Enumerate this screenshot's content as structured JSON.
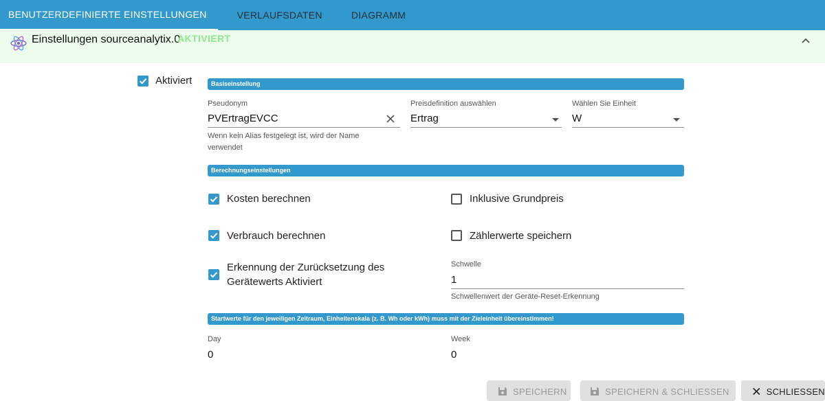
{
  "tabs": [
    {
      "label": "BENUTZERDEFINIERTE EINSTELLUNGEN"
    },
    {
      "label": "VERLAUFSDATEN"
    },
    {
      "label": "DIAGRAMM"
    }
  ],
  "accordion": {
    "title": "Einstellungen sourceanalytix.0",
    "status": "AKTIVIERT"
  },
  "enabled": {
    "label": "Aktiviert",
    "checked": true
  },
  "sections": {
    "basic": "Basiseinstellung",
    "calc": "Berechnungseinstellungen",
    "start": "Startwerte für den jeweiligen Zeitraum, Einheitenskala (z. B. Wh oder kWh) muss mit der Zieleinheit übereinstimmen!"
  },
  "alias": {
    "label": "Pseudonym",
    "value": "PVErtragEVCC",
    "helper_line1": "Wenn kein Alias festgelegt ist, wird der Name",
    "helper_line2": "verwendet"
  },
  "price": {
    "label": "Preisdefinition auswählen",
    "value": "Ertrag"
  },
  "unit": {
    "label": "Wählen Sie Einheit",
    "value": "W"
  },
  "checks": {
    "costs": {
      "label": "Kosten berechnen",
      "checked": true
    },
    "base_price": {
      "label": "Inklusive Grundpreis",
      "checked": false
    },
    "consumption": {
      "label": "Verbrauch berechnen",
      "checked": true
    },
    "meter_values": {
      "label": "Zählerwerte speichern",
      "checked": false
    },
    "reset_detect": {
      "label_line1": "Erkennung der Zurücksetzung des",
      "label_line2": "Gerätewerts Aktiviert",
      "checked": true
    }
  },
  "threshold": {
    "label": "Schwelle",
    "value": "1",
    "helper": "Schwellenwert der Geräte-Reset-Erkennung"
  },
  "start_values": {
    "day": {
      "label": "Day",
      "value": "0"
    },
    "week": {
      "label": "Week",
      "value": "0"
    }
  },
  "buttons": {
    "save": "SPEICHERN",
    "save_close": "SPEICHERN & SCHLIESSEN",
    "close": "SCHLIESSEN"
  },
  "colors": {
    "accent": "#3399cc",
    "active_green": "#8ee88e",
    "accordion_bg": "#ecfbec"
  }
}
